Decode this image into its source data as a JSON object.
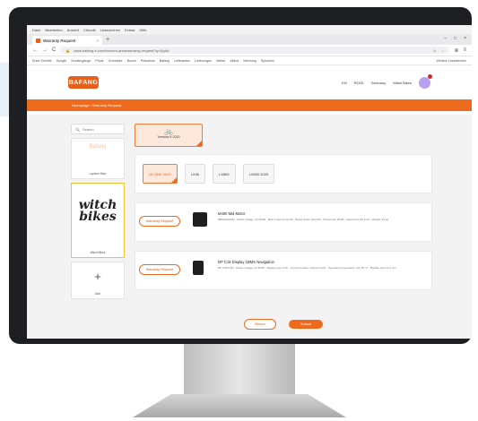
{
  "browser": {
    "menu": [
      "Datei",
      "Bearbeiten",
      "Ansicht",
      "Chronik",
      "Lesezeichen",
      "Extras",
      "Hilfe"
    ],
    "tab_title": "Warranty Request",
    "tab_close": "×",
    "new_tab": "+",
    "window_controls": [
      "–",
      "□",
      "×"
    ],
    "nav": {
      "back": "←",
      "forward": "→",
      "reload": "C"
    },
    "url": "www.bafang-e.com/en/oem-area/warranty-request?ty=&pid=",
    "bookmarks": [
      "Erste Schritte",
      "Google",
      "Studiengänge",
      "Privat",
      "Schneider",
      "Bosch",
      "Präsidium",
      "Bafang",
      "Lieferanten",
      "Lieferungen",
      "Weiter",
      "Akkus",
      "Werbung",
      "Sprachen"
    ],
    "bookmarks_right": "Weitere Lesezeichen"
  },
  "site": {
    "logo": "BAFANG",
    "header_links": [
      "EN",
      "ROLE",
      "Germany",
      "Witch Bikes"
    ],
    "breadcrumb": "Homepage › Warranty Request"
  },
  "sidebar": {
    "search_placeholder": "Search",
    "cards": [
      {
        "ghost": "Bafang",
        "label": "Lapierre Bike"
      },
      {
        "brand_line1": "witch",
        "brand_line2": "bikes",
        "label": "Witch Bikes"
      },
      {
        "label": "Add"
      }
    ]
  },
  "main": {
    "bike_label": "Ventura H 2020",
    "models": [
      "LE ONE 2020",
      "LX06",
      "LX800",
      "LX600 2020"
    ],
    "products": [
      {
        "button": "Warranty Request",
        "title": "M400 Mid Motor",
        "desc": "BBS01/02/HD · Rated voltage (V) 36/48 · Max torque (N·m) 80 · Rated power (W) 250 · Wheel size 26/28 · Speed limit 25 km/h · Weight 3.9 kg"
      },
      {
        "button": "Warranty Request",
        "title": "DP C18 Display 1BMS Navigation",
        "desc": "DP C18.CAN · Rated voltage (V) 36/48 · Display type LCD · Communication protocol CAN · Operating temperature -20~45 °C · Bracket size 22.2 mm"
      }
    ],
    "return_label": "Return",
    "submit_label": "Submit"
  },
  "colors": {
    "accent": "#f06a1e",
    "accent_light": "#fde9dc",
    "avatar": "#b9a0f0"
  }
}
